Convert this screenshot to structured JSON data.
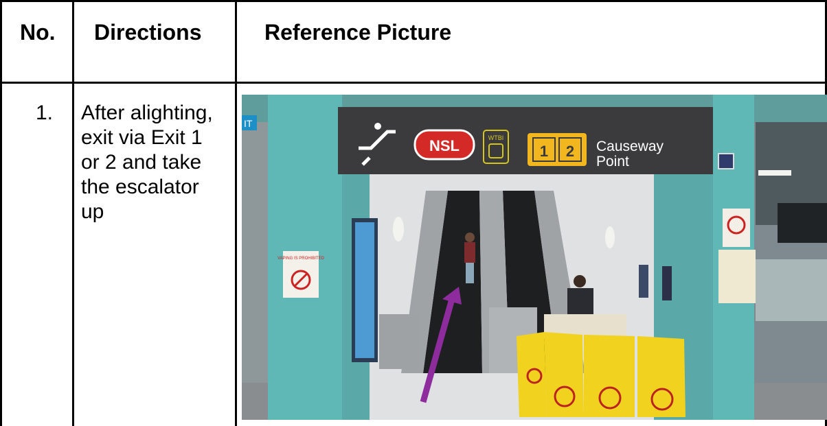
{
  "table": {
    "headers": {
      "no": "No.",
      "directions": "Directions",
      "picture": "Reference Picture"
    },
    "rows": [
      {
        "no": "1.",
        "direction": "After alighting, exit via Exit 1 or 2 and take the escalator up"
      }
    ]
  },
  "photo": {
    "sign": {
      "line_badge": "NSL",
      "bus_badge": "WTBI",
      "exit_1": "1",
      "exit_2": "2",
      "destination_line1": "Causeway",
      "destination_line2": "Point"
    },
    "left_edge_sign": "IT",
    "poster_text": "VAPING IS PROHIBITED",
    "colors": {
      "pillar": "#5fb7b6",
      "sign_panel": "#3b3b3d",
      "nsl_red": "#d42a27",
      "exit_yellow": "#f2b61f",
      "barrier_yellow": "#f1d21f",
      "arrow": "#8e2c9e"
    }
  }
}
